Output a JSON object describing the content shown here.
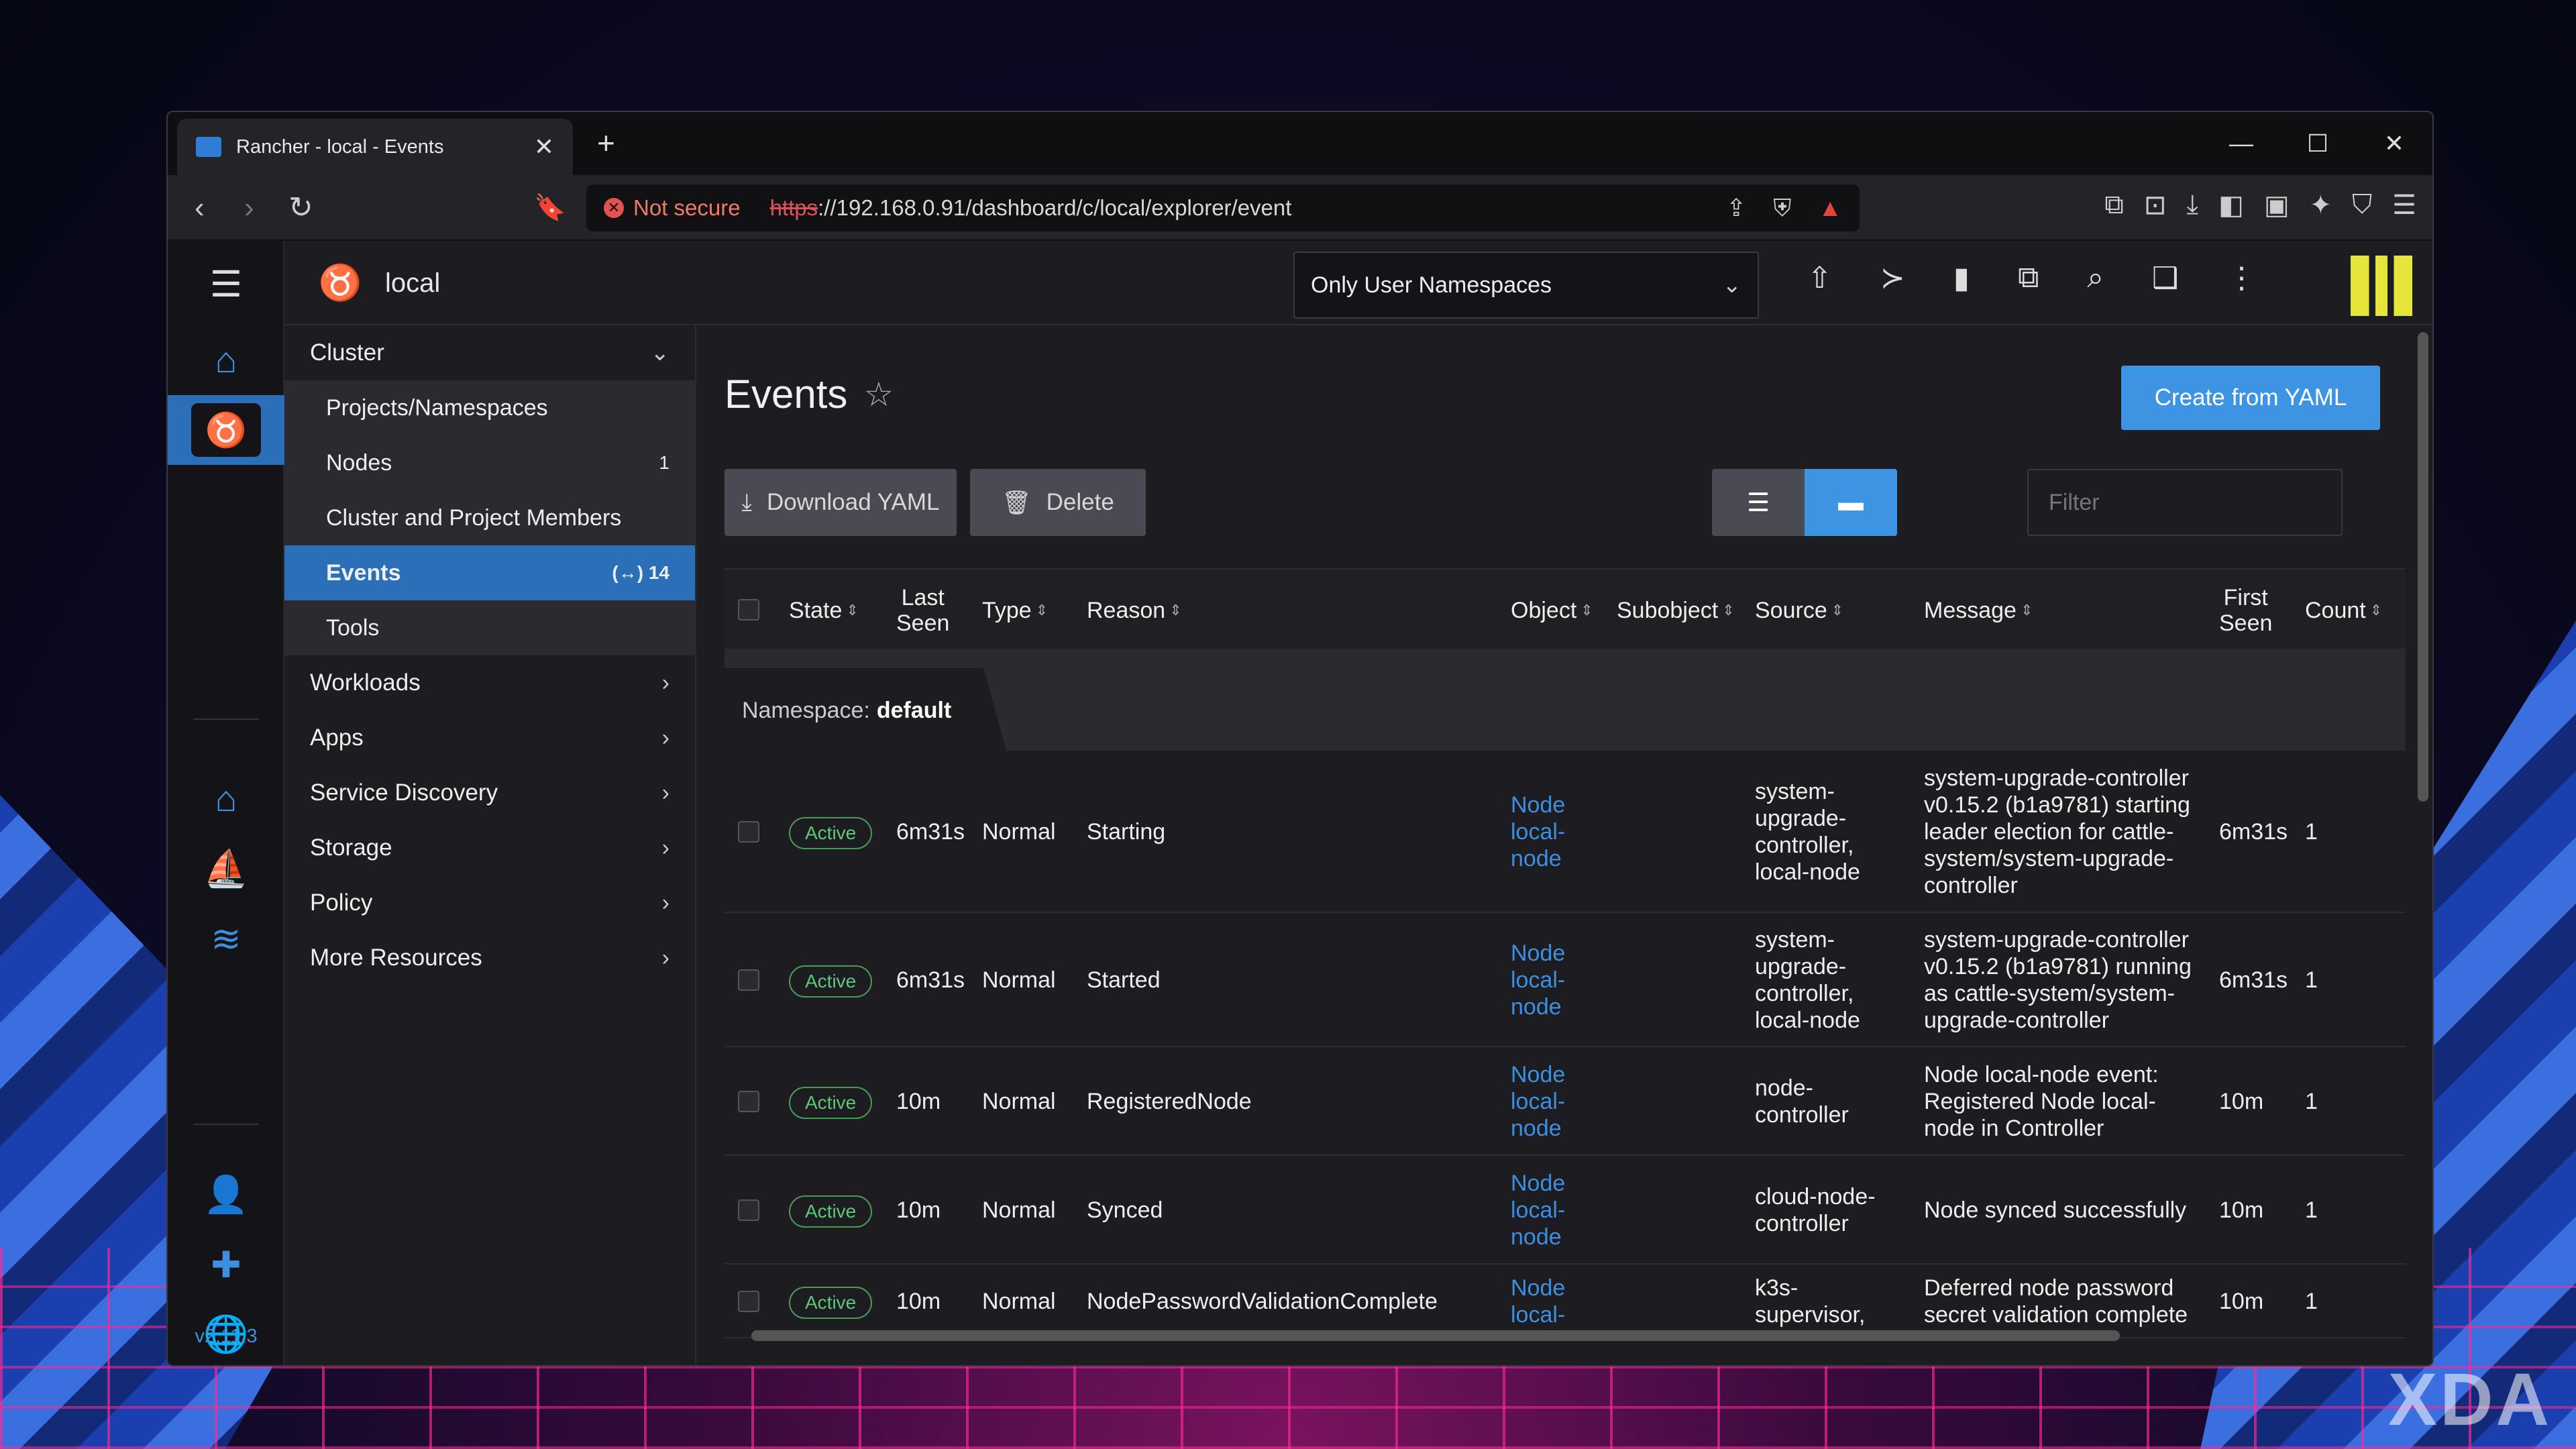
{
  "browser": {
    "tab_title": "Rancher - local - Events",
    "not_secure": "Not secure",
    "url_scheme": "https",
    "url_rest": "://192.168.0.91/dashboard/c/local/explorer/event"
  },
  "header": {
    "cluster_name": "local",
    "namespace_filter": "Only User Namespaces"
  },
  "rail": {
    "version": "v2.11.3"
  },
  "sidebar": {
    "cluster": "Cluster",
    "cluster_items": [
      {
        "label": "Projects/Namespaces",
        "count": ""
      },
      {
        "label": "Nodes",
        "count": "1"
      },
      {
        "label": "Cluster and Project Members",
        "count": ""
      },
      {
        "label": "Events",
        "count": "14"
      },
      {
        "label": "Tools",
        "count": ""
      }
    ],
    "groups": [
      "Workloads",
      "Apps",
      "Service Discovery",
      "Storage",
      "Policy",
      "More Resources"
    ]
  },
  "page": {
    "title": "Events",
    "create_btn": "Create from YAML",
    "download_btn": "Download YAML",
    "delete_btn": "Delete",
    "filter_placeholder": "Filter"
  },
  "table": {
    "columns": {
      "state": "State",
      "last_seen_1": "Last",
      "last_seen_2": "Seen",
      "type": "Type",
      "reason": "Reason",
      "object": "Object",
      "subobject": "Subobject",
      "source": "Source",
      "message": "Message",
      "first_seen_1": "First",
      "first_seen_2": "Seen",
      "count": "Count"
    },
    "group_label": "Namespace:",
    "group_value": "default",
    "rows": [
      {
        "state": "Active",
        "last_seen": "6m31s",
        "type": "Normal",
        "reason": "Starting",
        "object": [
          "Node",
          "local-",
          "node"
        ],
        "source": [
          "system-",
          "upgrade-",
          "controller,",
          "local-node"
        ],
        "message": [
          "system-upgrade-controller",
          "v0.15.2 (b1a9781) starting",
          "leader election for cattle-",
          "system/system-upgrade-",
          "controller"
        ],
        "first_seen": "6m31s",
        "count": "1"
      },
      {
        "state": "Active",
        "last_seen": "6m31s",
        "type": "Normal",
        "reason": "Started",
        "object": [
          "Node",
          "local-",
          "node"
        ],
        "source": [
          "system-",
          "upgrade-",
          "controller,",
          "local-node"
        ],
        "message": [
          "system-upgrade-controller",
          "v0.15.2 (b1a9781) running",
          "as cattle-system/system-",
          "upgrade-controller"
        ],
        "first_seen": "6m31s",
        "count": "1"
      },
      {
        "state": "Active",
        "last_seen": "10m",
        "type": "Normal",
        "reason": "RegisteredNode",
        "object": [
          "Node",
          "local-",
          "node"
        ],
        "source": [
          "node-",
          "controller"
        ],
        "message": [
          "Node local-node event:",
          "Registered Node local-",
          "node in Controller"
        ],
        "first_seen": "10m",
        "count": "1"
      },
      {
        "state": "Active",
        "last_seen": "10m",
        "type": "Normal",
        "reason": "Synced",
        "object": [
          "Node",
          "local-",
          "node"
        ],
        "source": [
          "cloud-node-",
          "controller"
        ],
        "message": [
          "Node synced successfully"
        ],
        "first_seen": "10m",
        "count": "1"
      },
      {
        "state": "Active",
        "last_seen": "10m",
        "type": "Normal",
        "reason": "NodePasswordValidationComplete",
        "object": [
          "Node",
          "local-"
        ],
        "source": [
          "k3s-",
          "supervisor,"
        ],
        "message": [
          "Deferred node password",
          "secret validation complete"
        ],
        "first_seen": "10m",
        "count": "1"
      }
    ]
  },
  "watermark": "XDA"
}
